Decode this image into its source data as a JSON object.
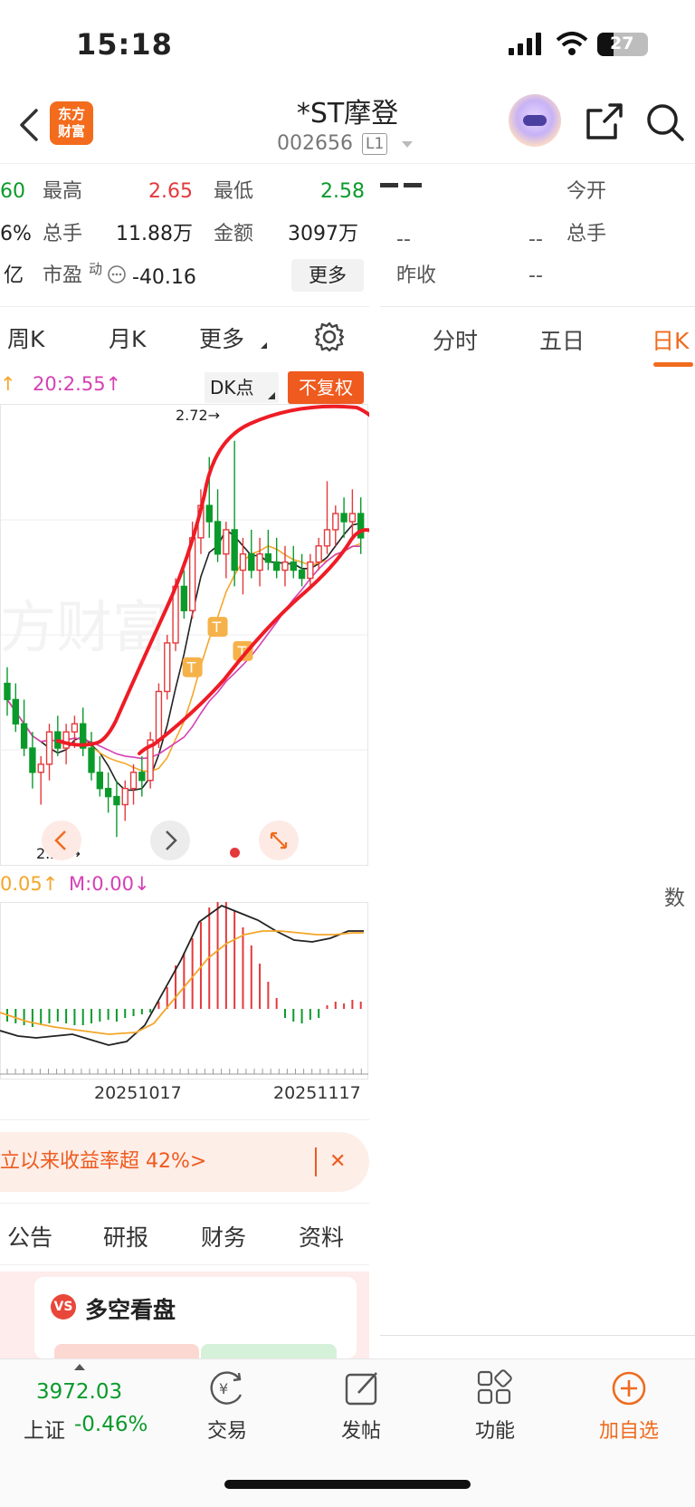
{
  "status_bar": {
    "time": "15:18",
    "battery": "27"
  },
  "header": {
    "logo_text_line1": "东方",
    "logo_text_line2": "财富",
    "stock_name": "*ST摩登",
    "stock_code": "002656",
    "level": "L1"
  },
  "quote": {
    "row1": {
      "partial": "60",
      "high_label": "最高",
      "high": "2.65",
      "low_label": "最低",
      "low": "2.58"
    },
    "row2": {
      "partial": "6%",
      "turnover_label": "总手",
      "turnover": "11.88万",
      "amount_label": "金额",
      "amount": "3097万"
    },
    "row3": {
      "partial": "亿",
      "pe_label": "市盈",
      "pe_sup": "动",
      "pe": "-40.16",
      "more": "更多"
    }
  },
  "right_quote": {
    "dash_big": "--",
    "open_label": "今开",
    "v1": "--",
    "v2": "--",
    "turnover_label": "总手",
    "prev_label": "昨收",
    "prev": "--",
    "tabs": [
      "分时",
      "五日",
      "日K"
    ],
    "partial_text": "数"
  },
  "chart_tabs": [
    "周K",
    "月K",
    "更多",
    "settings"
  ],
  "ma_labels": {
    "arrow": "↑",
    "ma20": "20:2.55↑"
  },
  "buttons": {
    "dk": "DK点",
    "fuquan": "不复权"
  },
  "chart_annotations": {
    "high_label": "2.72→",
    "low_label": "2.23→"
  },
  "macd_labels": {
    "dif": "0.05↑",
    "m": "M:0.00↓"
  },
  "dates": [
    "20251017",
    "20251117"
  ],
  "banner": {
    "text": "立以来收益率超 42%>",
    "close": "✕"
  },
  "info_tabs": [
    "公告",
    "研报",
    "财务",
    "资料"
  ],
  "card": {
    "title": "多空看盘",
    "vs": "VS"
  },
  "bottom_bar": {
    "index_value": "3972.03",
    "index_name": "上证",
    "index_change": "-0.46%",
    "items": [
      "交易",
      "发帖",
      "功能",
      "加自选"
    ]
  },
  "colors": {
    "up": "#e4393c",
    "down": "#0a9a2b",
    "accent": "#ef6b1e",
    "ma20": "#d63fb5"
  },
  "chart_data": {
    "type": "candlestick",
    "ohlc": [
      [
        2.42,
        2.44,
        2.38,
        2.4
      ],
      [
        2.4,
        2.42,
        2.36,
        2.37
      ],
      [
        2.37,
        2.4,
        2.33,
        2.34
      ],
      [
        2.34,
        2.36,
        2.29,
        2.31
      ],
      [
        2.31,
        2.33,
        2.27,
        2.32
      ],
      [
        2.32,
        2.37,
        2.3,
        2.36
      ],
      [
        2.36,
        2.38,
        2.33,
        2.34
      ],
      [
        2.34,
        2.37,
        2.32,
        2.36
      ],
      [
        2.36,
        2.38,
        2.34,
        2.37
      ],
      [
        2.37,
        2.39,
        2.33,
        2.34
      ],
      [
        2.34,
        2.36,
        2.3,
        2.31
      ],
      [
        2.31,
        2.33,
        2.28,
        2.29
      ],
      [
        2.29,
        2.31,
        2.26,
        2.28
      ],
      [
        2.28,
        2.3,
        2.23,
        2.27
      ],
      [
        2.27,
        2.3,
        2.25,
        2.29
      ],
      [
        2.29,
        2.32,
        2.27,
        2.31
      ],
      [
        2.31,
        2.33,
        2.28,
        2.3
      ],
      [
        2.3,
        2.36,
        2.29,
        2.35
      ],
      [
        2.35,
        2.42,
        2.34,
        2.41
      ],
      [
        2.41,
        2.48,
        2.4,
        2.47
      ],
      [
        2.47,
        2.55,
        2.46,
        2.54
      ],
      [
        2.54,
        2.56,
        2.5,
        2.51
      ],
      [
        2.51,
        2.62,
        2.5,
        2.6
      ],
      [
        2.6,
        2.66,
        2.58,
        2.64
      ],
      [
        2.64,
        2.7,
        2.6,
        2.62
      ],
      [
        2.62,
        2.66,
        2.57,
        2.58
      ],
      [
        2.58,
        2.62,
        2.55,
        2.61
      ],
      [
        2.61,
        2.72,
        2.54,
        2.56
      ],
      [
        2.56,
        2.6,
        2.53,
        2.58
      ],
      [
        2.58,
        2.61,
        2.55,
        2.56
      ],
      [
        2.56,
        2.6,
        2.54,
        2.58
      ],
      [
        2.58,
        2.61,
        2.56,
        2.57
      ],
      [
        2.57,
        2.6,
        2.55,
        2.56
      ],
      [
        2.56,
        2.59,
        2.54,
        2.57
      ],
      [
        2.57,
        2.59,
        2.55,
        2.56
      ],
      [
        2.56,
        2.58,
        2.54,
        2.55
      ],
      [
        2.55,
        2.58,
        2.54,
        2.57
      ],
      [
        2.57,
        2.6,
        2.56,
        2.59
      ],
      [
        2.59,
        2.67,
        2.58,
        2.61
      ],
      [
        2.61,
        2.64,
        2.59,
        2.63
      ],
      [
        2.63,
        2.65,
        2.6,
        2.62
      ],
      [
        2.62,
        2.66,
        2.6,
        2.63
      ],
      [
        2.63,
        2.65,
        2.58,
        2.6
      ]
    ],
    "ylim": [
      2.2,
      2.76
    ],
    "price_labels": {
      "high": 2.72,
      "low": 2.23
    }
  }
}
